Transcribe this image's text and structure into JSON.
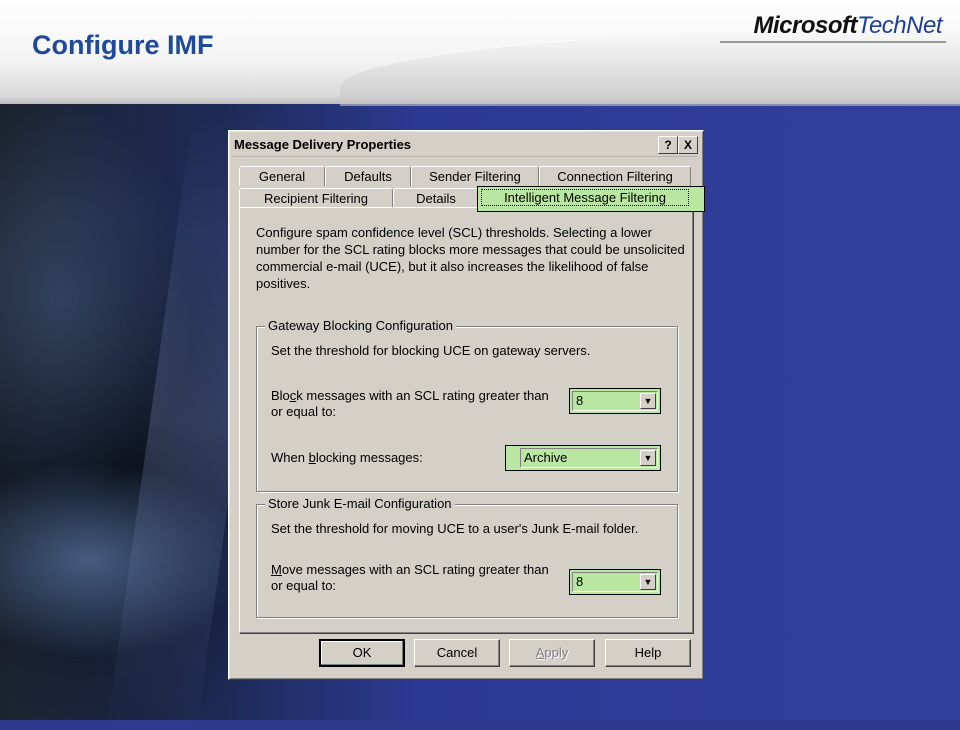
{
  "slide": {
    "title": "Configure IMF",
    "brand_microsoft": "Microsoft",
    "brand_technet": "TechNet"
  },
  "dialog": {
    "title": "Message Delivery Properties",
    "help_button": "?",
    "close_button": "X",
    "tabs_row1": [
      "General",
      "Defaults",
      "Sender Filtering",
      "Connection Filtering"
    ],
    "tabs_row2": [
      "Recipient Filtering",
      "Details",
      "Intelligent Message Filtering"
    ],
    "active_tab": "Intelligent Message Filtering",
    "description": "Configure spam confidence level (SCL) thresholds. Selecting a lower number for the SCL rating blocks more messages that could be unsolicited commercial e-mail (UCE), but it also increases the likelihood of false positives.",
    "gateway": {
      "title": "Gateway Blocking Configuration",
      "help_text": "Set the threshold for blocking UCE on gateway servers.",
      "block_label_pre": "Blo",
      "block_label_accel": "c",
      "block_label_post": "k messages with an SCL rating greater than or equal to:",
      "block_value": "8",
      "when_label_pre": "When ",
      "when_label_accel": "b",
      "when_label_post": "locking messages:",
      "when_value": "Archive"
    },
    "store": {
      "title": "Store Junk E-mail Configuration",
      "help_text": "Set the threshold for moving UCE to a user's Junk E-mail folder.",
      "move_label_accel": "M",
      "move_label_post": "ove messages with an SCL rating greater than or equal to:",
      "move_value": "8"
    },
    "buttons": {
      "ok": "OK",
      "cancel": "Cancel",
      "apply_accel": "A",
      "apply_post": "pply",
      "help": "Help"
    }
  },
  "colors": {
    "title_blue": "#1f4a9c",
    "highlight_green": "#b9e6a0",
    "dialog_gray": "#d4d0c8"
  }
}
